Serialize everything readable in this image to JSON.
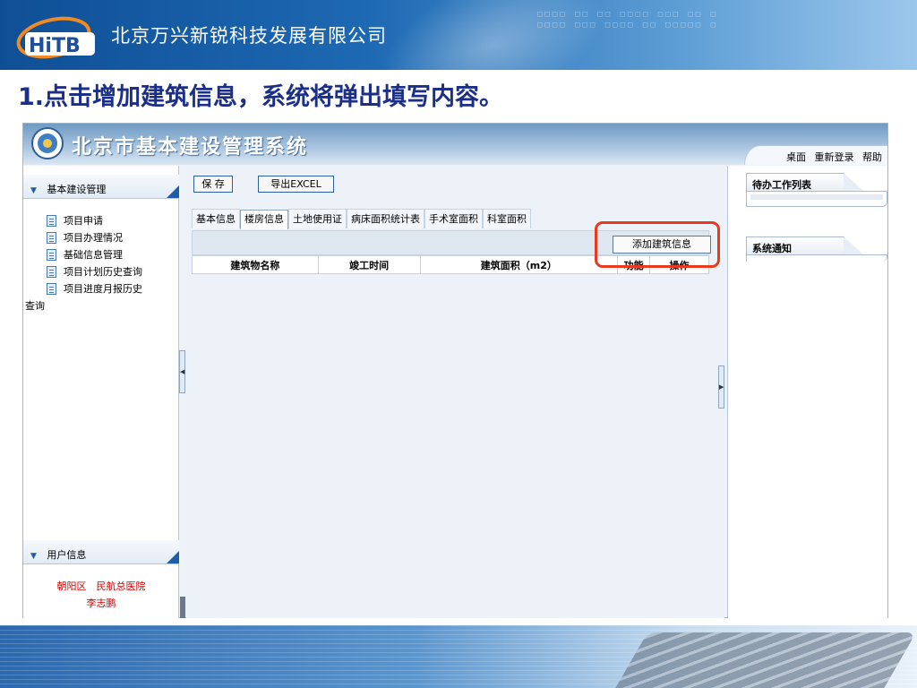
{
  "banner": {
    "company": "北京万兴新锐科技发展有限公司",
    "logo_text": "HiTB"
  },
  "slide": {
    "title": "1.点击增加建筑信息，系统将弹出填写内容。"
  },
  "app": {
    "title": "北京市基本建设管理系统",
    "top_links": [
      "桌面",
      "重新登录",
      "帮助"
    ]
  },
  "sidebar": {
    "section_title": "基本建设管理",
    "items": [
      "项目申请",
      "项目办理情况",
      "基础信息管理",
      "项目计划历史查询",
      "项目进度月报历史"
    ],
    "item_tail": "查询",
    "user_section_title": "用户信息",
    "user_org": "朝阳区　民航总医院",
    "user_name": "李志鹏"
  },
  "toolbar": {
    "save_label": "保 存",
    "export_label": "导出EXCEL"
  },
  "tabs": [
    "基本信息",
    "楼房信息",
    "土地使用证",
    "病床面积统计表",
    "手术室面积",
    "科室面积"
  ],
  "active_tab_index": 1,
  "table": {
    "add_label": "添加建筑信息",
    "columns": [
      "建筑物名称",
      "竣工时间",
      "建筑面积（m2）",
      "功能",
      "操作"
    ]
  },
  "right_panel": {
    "todo_title": "待办工作列表",
    "notice_title": "系统通知"
  },
  "colors": {
    "highlight": "#e83a1e",
    "slide_title": "#1b2f86",
    "user_info": "#cc0000"
  }
}
